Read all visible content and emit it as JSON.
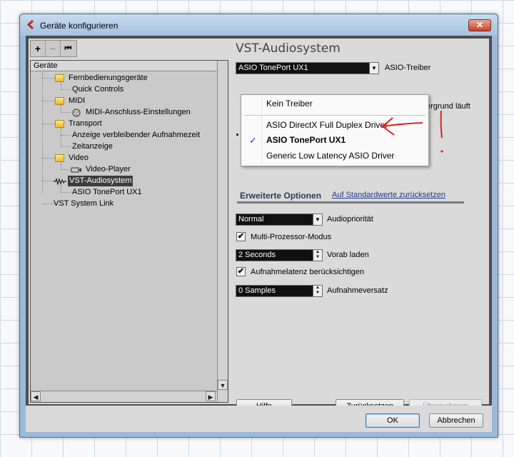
{
  "window": {
    "title": "Geräte konfigurieren",
    "close_label": "✕"
  },
  "toolbar": {
    "add_label": "+",
    "remove_label": "−",
    "reset_label": "⏮"
  },
  "tree": {
    "header": "Geräte",
    "items": [
      {
        "label": "Fernbedienungsgeräte",
        "icon": "folder-icon"
      },
      {
        "label": "Quick Controls"
      },
      {
        "label": "MIDI",
        "icon": "folder-icon"
      },
      {
        "label": "MIDI-Anschluss-Einstellungen",
        "icon": "midi-port-icon"
      },
      {
        "label": "Transport",
        "icon": "folder-icon"
      },
      {
        "label": "Anzeige verbleibender Aufnahmezeit"
      },
      {
        "label": "Zeitanzeige"
      },
      {
        "label": "Video",
        "icon": "folder-icon"
      },
      {
        "label": "Video-Player",
        "icon": "video-icon"
      },
      {
        "label": "VST-Audiosystem",
        "icon": "audio-icon",
        "selected": true
      },
      {
        "label": "ASIO TonePort UX1"
      },
      {
        "label": "VST System Link"
      }
    ]
  },
  "panel": {
    "title": "VST-Audiosystem",
    "driver_value": "ASIO TonePort UX1",
    "driver_label": "ASIO-Treiber",
    "hidden_text": "ergrund läuft"
  },
  "popup": {
    "items": [
      {
        "label": "Kein Treiber",
        "checked": false
      },
      {
        "label": "ASIO DirectX Full Duplex Driver",
        "checked": false
      },
      {
        "label": "ASIO TonePort UX1",
        "checked": true
      },
      {
        "label": "Generic Low Latency ASIO Driver",
        "checked": false
      }
    ],
    "check_mark": "✓"
  },
  "options": {
    "title": "Erweiterte Optionen",
    "reset_link": "Auf Standardwerte zurücksetzen",
    "priority_value": "Normal",
    "priority_label": "Audiopriorität",
    "multiproc_label": "Multi-Prozessor-Modus",
    "multiproc_checked": true,
    "preload_value": "2 Seconds",
    "preload_label": "Vorab laden",
    "latency_label": "Aufnahmelatenz berücksichtigen",
    "latency_checked": true,
    "offset_value": "0 Samples",
    "offset_label": "Aufnahmeversatz"
  },
  "buttons": {
    "help": "Hilfe",
    "reset": "Zurücksetzen",
    "apply": "Übernehmen",
    "ok": "OK",
    "cancel": "Abbrechen"
  },
  "annotation": {
    "color": "#e02020",
    "text": "!"
  }
}
